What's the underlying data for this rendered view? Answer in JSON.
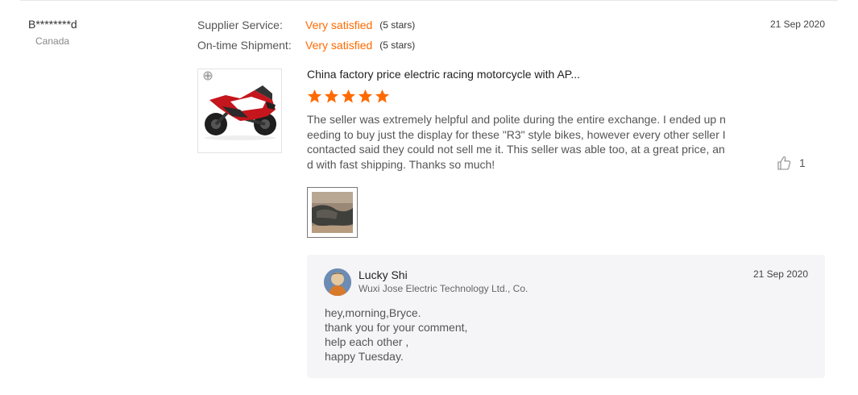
{
  "buyer": {
    "name": "B********d",
    "country": "Canada"
  },
  "ratings": [
    {
      "label": "Supplier Service:",
      "value": "Very satisfied",
      "stars_text": "(5 stars)"
    },
    {
      "label": "On-time Shipment:",
      "value": "Very satisfied",
      "stars_text": "(5 stars)"
    }
  ],
  "review": {
    "date": "21 Sep 2020",
    "product_title": "China factory price electric racing motorcycle with AP...",
    "stars": 5,
    "text": "The seller was extremely helpful and polite during the entire exchange. I ended up needing to buy just the display for these \"R3\" style bikes, however every other seller I contacted said they could not sell me it. This seller was able too, at a great price, and with fast shipping. Thanks so much!",
    "likes": "1"
  },
  "reply": {
    "name": "Lucky Shi",
    "company": "Wuxi Jose Electric Technology Ltd., Co.",
    "date": "21 Sep 2020",
    "lines": [
      "hey,morning,Bryce.",
      "thank you for your comment,",
      "help each other ,",
      "happy Tuesday."
    ]
  },
  "colors": {
    "accent": "#ff6a00",
    "reply_bg": "#f5f5f7"
  }
}
